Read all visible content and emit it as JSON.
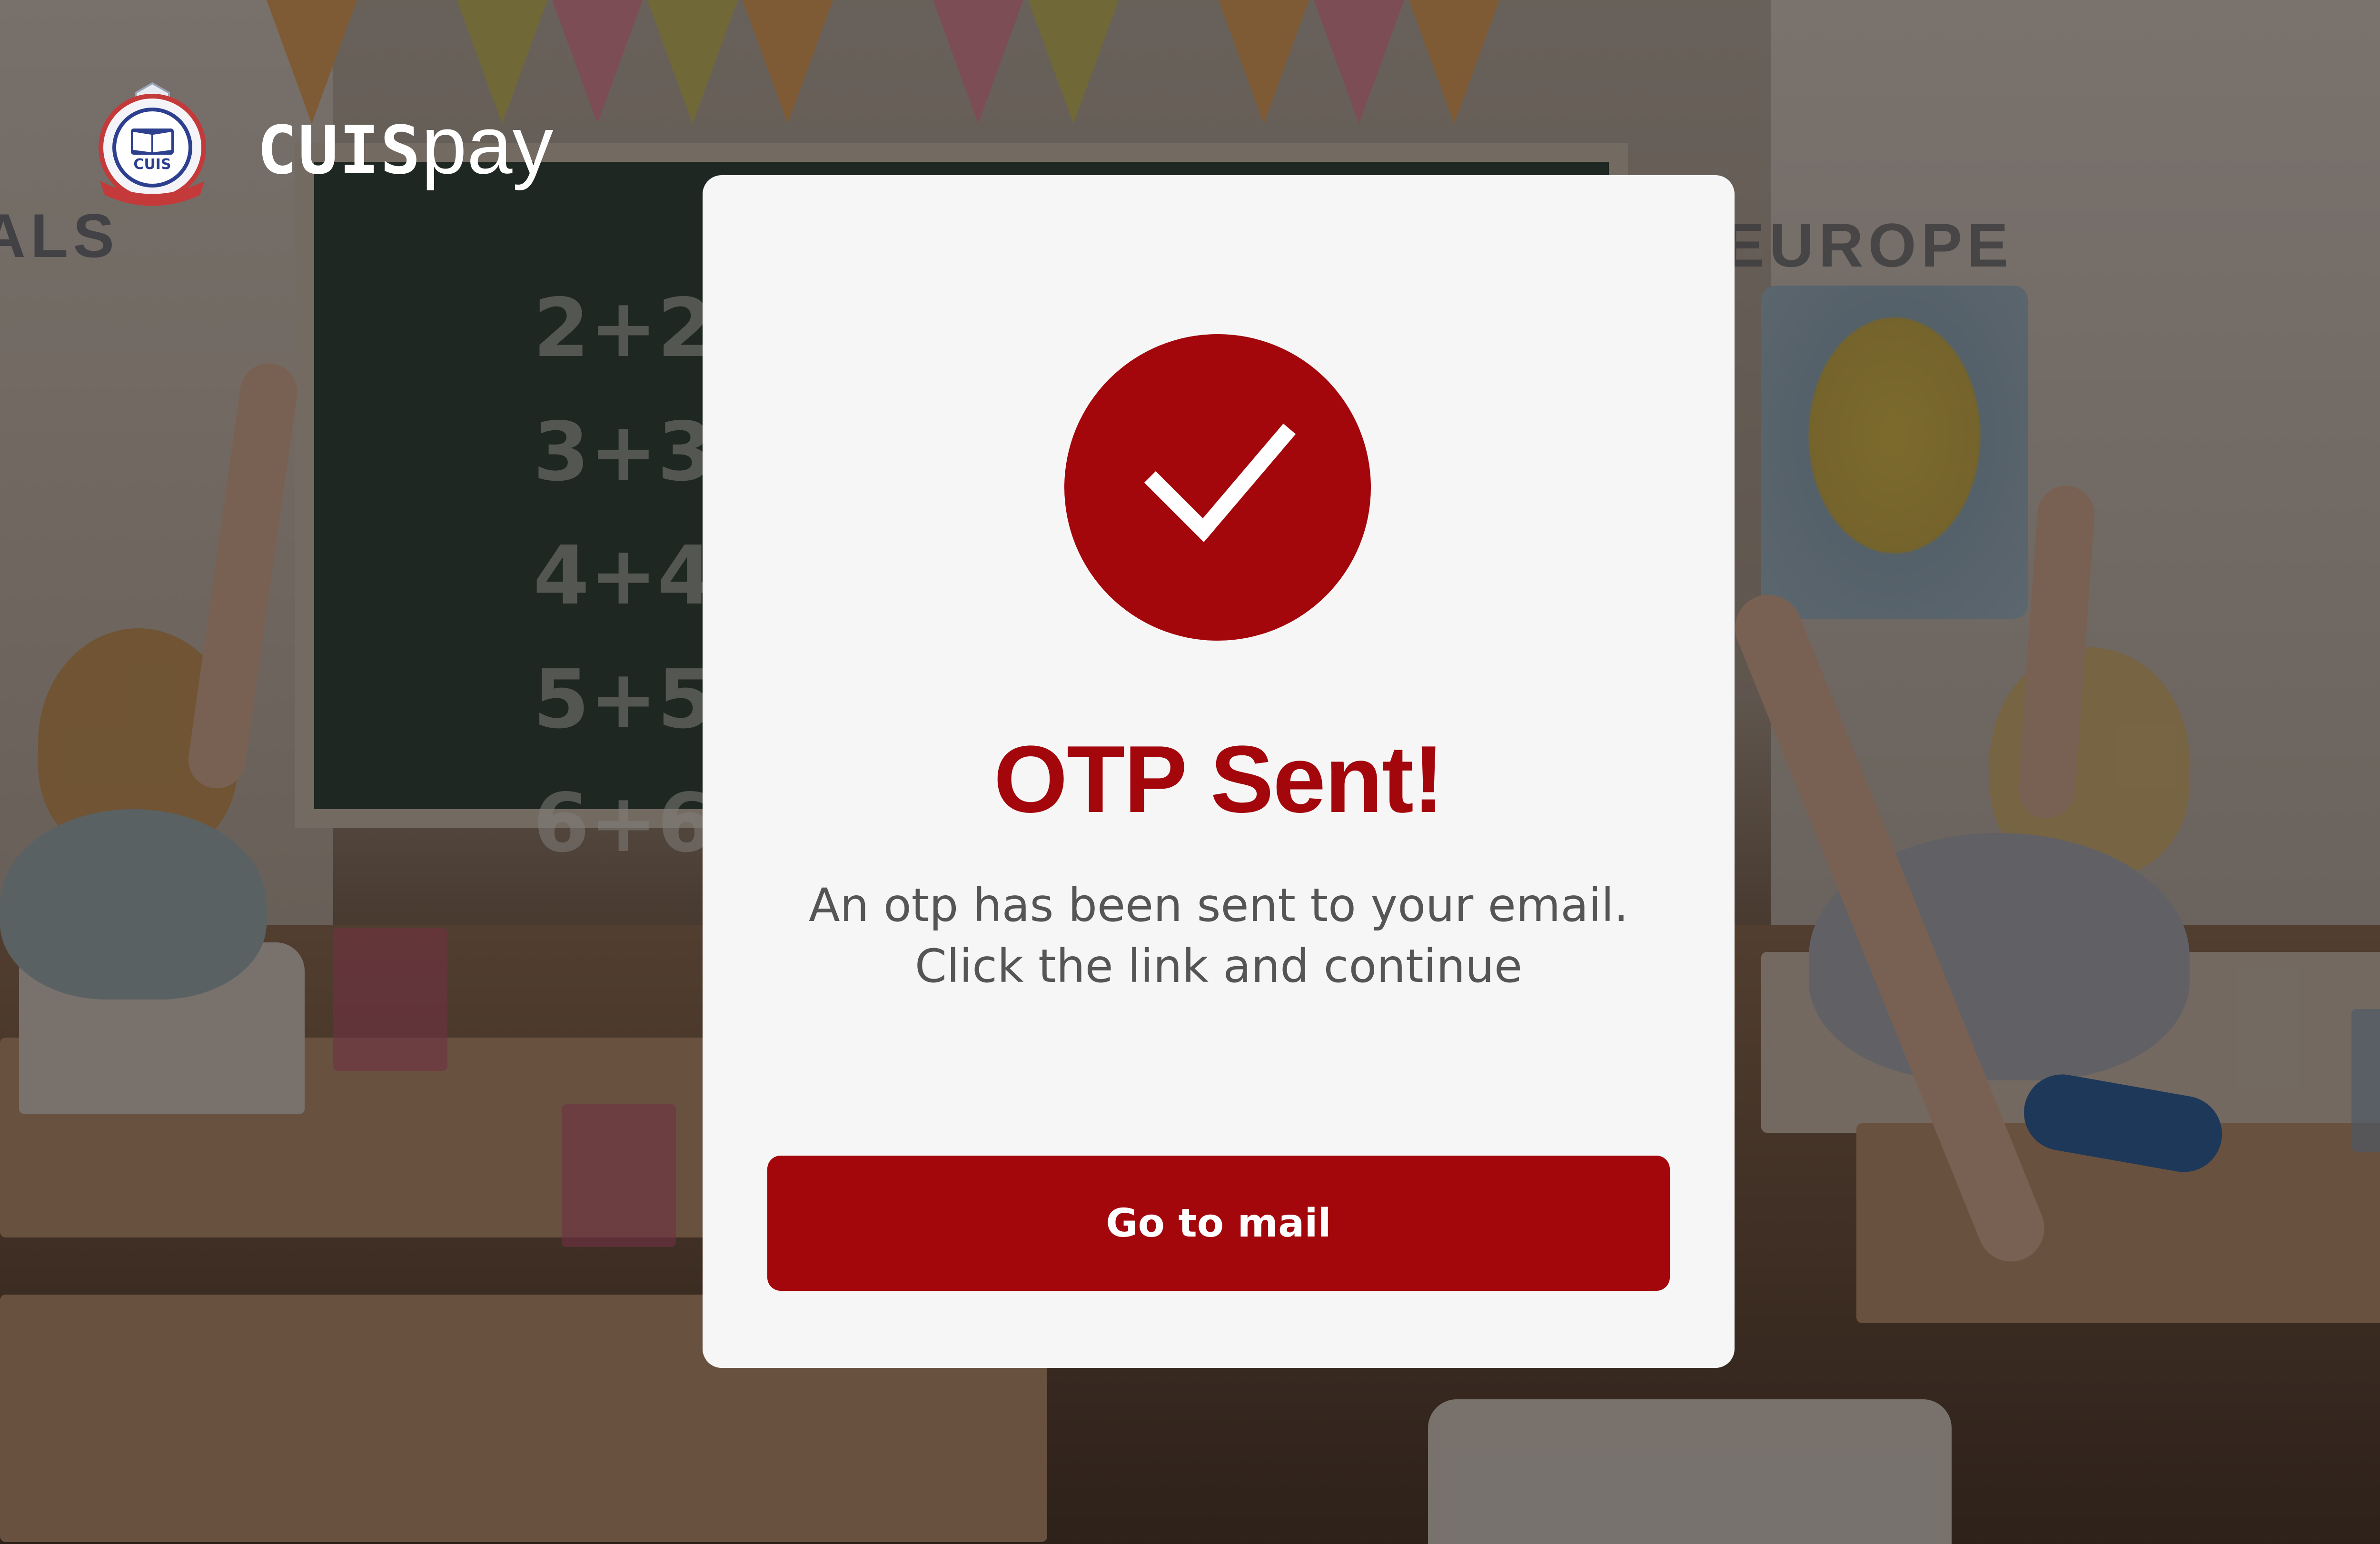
{
  "brand": {
    "name_bold": "CUIS",
    "name_light": "pay",
    "crest_text": "CUIS",
    "crest_icon": "school-crest-icon"
  },
  "modal": {
    "icon": "check-circle-icon",
    "title": "OTP Sent!",
    "message_line1": "An otp has been sent to your email.",
    "message_line2": "Click the link and continue",
    "button_label": "Go to mail"
  },
  "colors": {
    "accent": "#a3070c",
    "modal_background": "#f6f6f6",
    "message_text": "#555555"
  }
}
